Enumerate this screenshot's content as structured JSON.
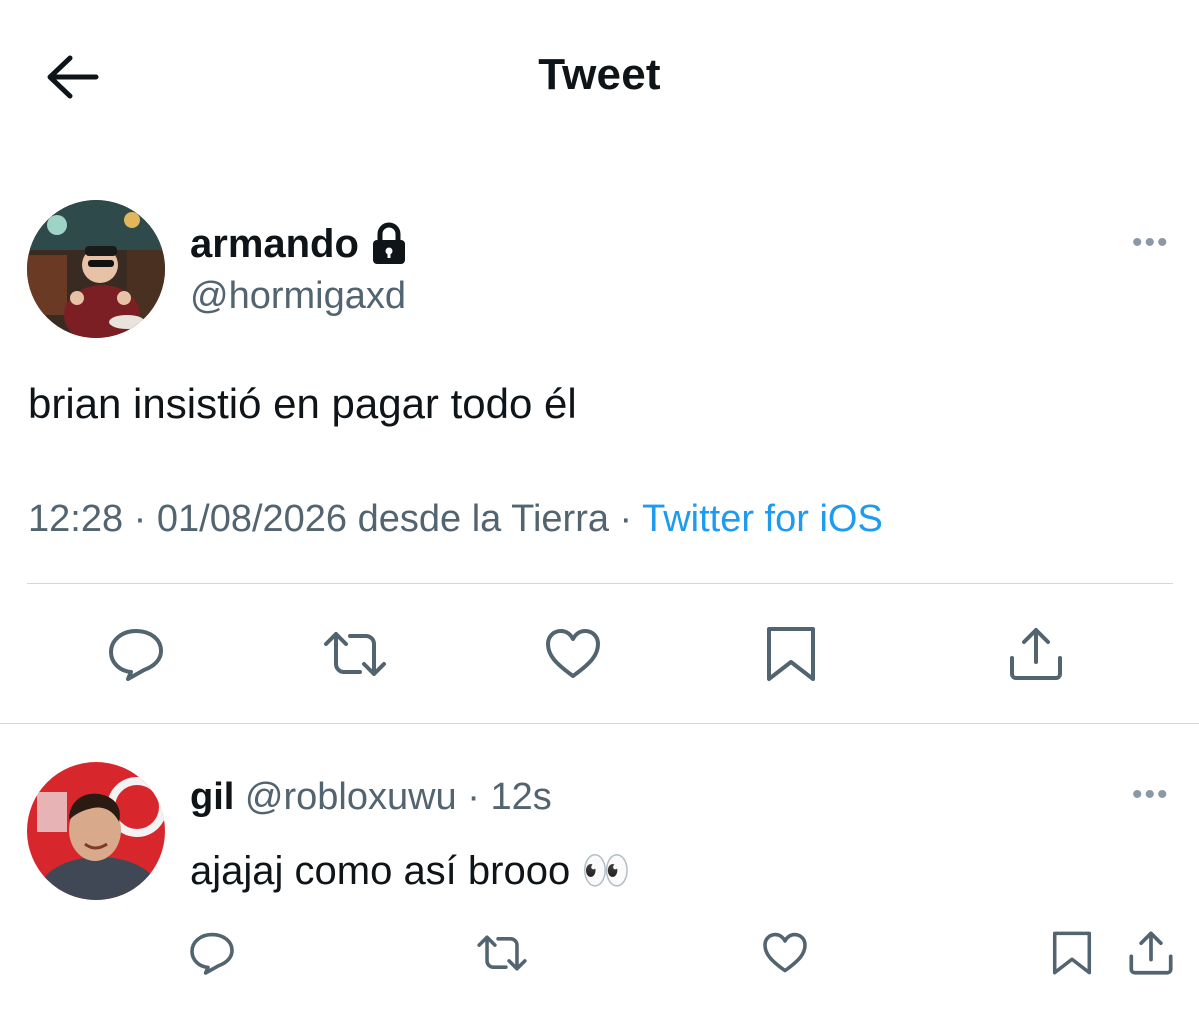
{
  "header": {
    "title": "Tweet",
    "back_icon": "arrow-left-icon"
  },
  "main_tweet": {
    "display_name": "armando",
    "handle": "@hormigaxd",
    "protected_icon": "lock-icon",
    "more_icon": "more-horizontal-icon",
    "more_label": "•••",
    "text": "brian insistió en pagar todo él",
    "time": "12:28",
    "sep1": " · ",
    "date_location": "01/08/2026 desde la Tierra",
    "sep2": " · ",
    "source": "Twitter for iOS",
    "actions": [
      "reply-icon",
      "retweet-icon",
      "like-icon",
      "bookmark-icon",
      "share-icon"
    ]
  },
  "reply": {
    "display_name": "gil",
    "handle": "@robloxuwu",
    "sep": " · ",
    "time": "12s",
    "text": "ajajaj como así brooo 👀",
    "more_label": "•••",
    "actions": [
      "reply-icon",
      "retweet-icon",
      "like-icon",
      "bookmark-icon",
      "share-icon"
    ]
  },
  "colors": {
    "accent": "#1d9bf0",
    "text": "#0f1419",
    "muted": "#536471",
    "divider": "#cfd9de"
  }
}
